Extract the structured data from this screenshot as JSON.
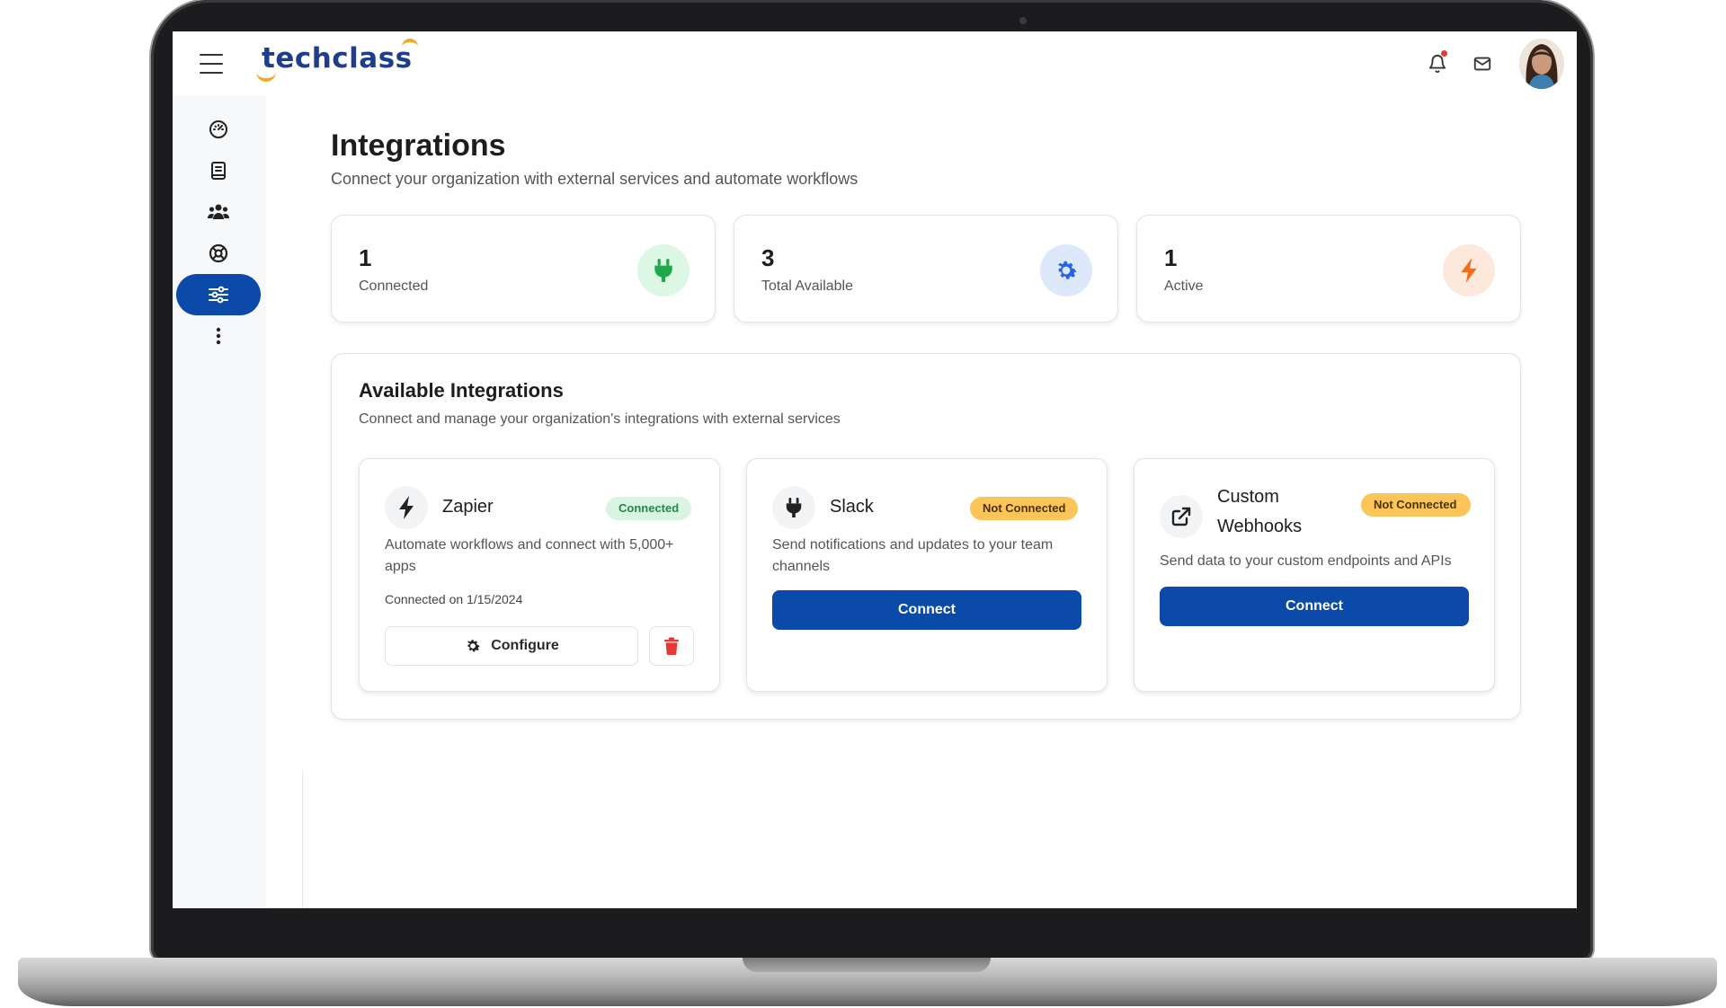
{
  "app": {
    "logo_text": "techclass"
  },
  "header": {
    "icons": [
      "menu-icon",
      "bell-icon",
      "mail-icon",
      "avatar"
    ]
  },
  "sidebar": {
    "items": [
      {
        "icon": "dashboard-icon",
        "active": false
      },
      {
        "icon": "book-icon",
        "active": false
      },
      {
        "icon": "users-icon",
        "active": false
      },
      {
        "icon": "support-icon",
        "active": false
      },
      {
        "icon": "sliders-icon",
        "active": true
      },
      {
        "icon": "more-icon",
        "active": false
      }
    ]
  },
  "page": {
    "title": "Integrations",
    "subtitle": "Connect your organization with external services and automate workflows"
  },
  "stats": [
    {
      "value": "1",
      "label": "Connected",
      "icon": "plug-icon",
      "color": "#1fa84b",
      "bg": "#dcf7e4"
    },
    {
      "value": "3",
      "label": "Total Available",
      "icon": "gear-icon",
      "color": "#2563eb",
      "bg": "#dde8fb"
    },
    {
      "value": "1",
      "label": "Active",
      "icon": "lightning-icon",
      "color": "#f26c1b",
      "bg": "#fde9dc"
    }
  ],
  "panel": {
    "title": "Available Integrations",
    "subtitle": "Connect and manage your organization's integrations with external services"
  },
  "integrations": [
    {
      "name": "Zapier",
      "icon": "lightning-icon",
      "status": "Connected",
      "description": "Automate workflows and connect with 5,000+ apps",
      "connected_on": "Connected on 1/15/2024",
      "configure_label": "Configure"
    },
    {
      "name": "Slack",
      "icon": "plug-icon",
      "status": "Not Connected",
      "description": "Send notifications and updates to your team channels",
      "connect_label": "Connect"
    },
    {
      "name": "Custom Webhooks",
      "icon": "external-link-icon",
      "status": "Not Connected",
      "description": "Send data to your custom endpoints and APIs",
      "connect_label": "Connect"
    }
  ],
  "colors": {
    "primary": "#0b4aa8",
    "danger": "#e53935",
    "warning": "#fcc55a",
    "success": "#1f8a46"
  }
}
